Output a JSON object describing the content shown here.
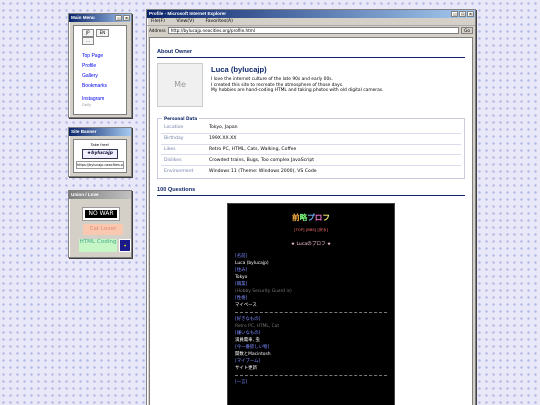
{
  "menu_window": {
    "title": "Main Menu",
    "lang_buttons": [
      "JP",
      "EN",
      "…"
    ],
    "links": [
      "Top Page",
      "Profile",
      "Gallery",
      "Bookmarks"
    ],
    "instagram": "Instagram",
    "instagram_sub": "Daily"
  },
  "banner_window": {
    "title": "Site Banner",
    "take_free": "Take free!",
    "banner_text": "★bylucajp",
    "url": "https://bylucajp.neocities.org/"
  },
  "unions_window": {
    "title": "Union / Love",
    "no_war": "NO WAR",
    "cat_lover": "Cat Lover",
    "html_coding": "HTML Coding"
  },
  "browser": {
    "title": "Profile - Microsoft Internet Explorer",
    "menus": [
      "File(F)",
      "View(V)",
      "Favorites(A)"
    ],
    "address_label": "Address",
    "address": "http://bylucajp.neocities.org/profile.html",
    "go": "Go"
  },
  "about": {
    "heading": "About Owner",
    "avatar_text": "Me",
    "name": "Luca (bylucajp)",
    "bio": [
      "I love the internet culture of the late 90s and early 00s.",
      "I created this site to recreate the atmosphere of those days.",
      "My hobbies are hand-coding HTML and taking photos with old digital cameras."
    ]
  },
  "personal": {
    "legend": "Personal Data",
    "rows": [
      {
        "k": "Location",
        "v": "Tokyo, Japan"
      },
      {
        "k": "Birthday",
        "v": "199X.XX.XX"
      },
      {
        "k": "Likes",
        "v": "Retro PC, HTML, Cats, Walking, Coffee"
      },
      {
        "k": "Dislikes",
        "v": "Crowded trains, Bugs, Too complex JavaScript"
      },
      {
        "k": "Environment",
        "v": "Windows 11 (Theme: Windows 2000), VS Code"
      }
    ]
  },
  "questions": {
    "heading": "100 Questions",
    "title": "前略プロフ",
    "nav": "[TOP] [BBS] [戻る]",
    "subtitle": "★ Lucaのプロフ ★",
    "items": [
      {
        "q": "[名前]",
        "a": "Luca (bylucajp)",
        "dim": false
      },
      {
        "q": "[住み]",
        "a": "Tokyo",
        "dim": false
      },
      {
        "q": "[職業]",
        "a": "(Hobby Security Guard is)",
        "dim": true
      },
      {
        "q": "[性格]",
        "a": "マイペース",
        "dim": false
      }
    ],
    "items2": [
      {
        "q": "[好きなもの]",
        "a": "Retro PC, HTML, Cat",
        "dim": true
      },
      {
        "q": "[嫌いなもの]",
        "a": "満員電車, 虫",
        "dim": false
      },
      {
        "q": "[今一番欲しい物]",
        "a": "関数とMacintosh",
        "dim": false
      },
      {
        "q": "[マイブーム]",
        "a": "サイト更新",
        "dim": false
      }
    ],
    "tail": "[一言]"
  }
}
